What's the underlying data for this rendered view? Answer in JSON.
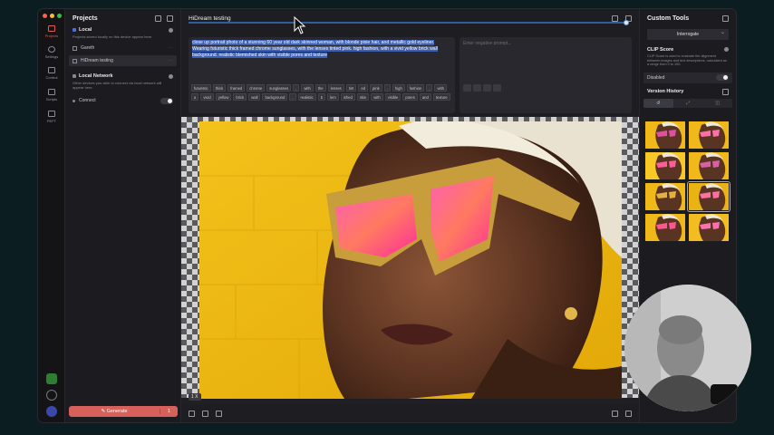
{
  "rail": {
    "items": [
      {
        "label": "Projects",
        "icon": "projects-icon",
        "active": true
      },
      {
        "label": "Settings",
        "icon": "gear-icon"
      },
      {
        "label": "Control",
        "icon": "sliders-icon"
      },
      {
        "label": "Scripts",
        "icon": "script-icon"
      },
      {
        "label": "PEFT",
        "icon": "peft-icon"
      }
    ]
  },
  "projects": {
    "title": "Projects",
    "local": {
      "title": "Local",
      "desc": "Projects stored locally on this device appear here."
    },
    "items": [
      {
        "name": "Gareth",
        "active": false
      },
      {
        "name": "HiDream testing",
        "active": true
      }
    ],
    "network": {
      "title": "Local Network",
      "desc": "Other devices you wish to connect via local network will appear here."
    },
    "connect_label": "Connect",
    "generate_label": "Generate",
    "generate_count": "1"
  },
  "main": {
    "title": "HiDream testing",
    "prompt": "close up portrait photo of a stunning 60 year old dark skinned woman, with blonde pixie hair, and metallic gold eyeliner. Wearing futuristic thick framed chrome sunglasses, with the lenses tinted pink. high fashion, with a vivid yellow brick wall background. realistic blemished skin with visible pores and texture",
    "tokens": [
      "futuristic",
      "thick",
      "framed",
      "chrome",
      "sunglasses",
      ",",
      "with",
      "the",
      "lenses",
      "tint",
      "ed",
      "pink",
      ".",
      "high",
      "fashion",
      ",",
      "with",
      "a",
      "vivid",
      "yellow",
      "brick",
      "wall",
      "background",
      ".",
      "realistic",
      "b",
      "lem",
      "ished",
      "skin",
      "with",
      "visible",
      "pores",
      "and",
      "texture"
    ],
    "negative_placeholder": "Enter negative prompt...",
    "zoom": "1 X"
  },
  "right": {
    "title": "Custom Tools",
    "interrogate": "Interrogate",
    "clip_title": "CLIP Score",
    "clip_desc": "CLIP Score is used to evaluate the alignment between images and text descriptions, calculated as a range from 0 to 100.",
    "disabled_label": "Disabled",
    "version_history": "Version History"
  }
}
